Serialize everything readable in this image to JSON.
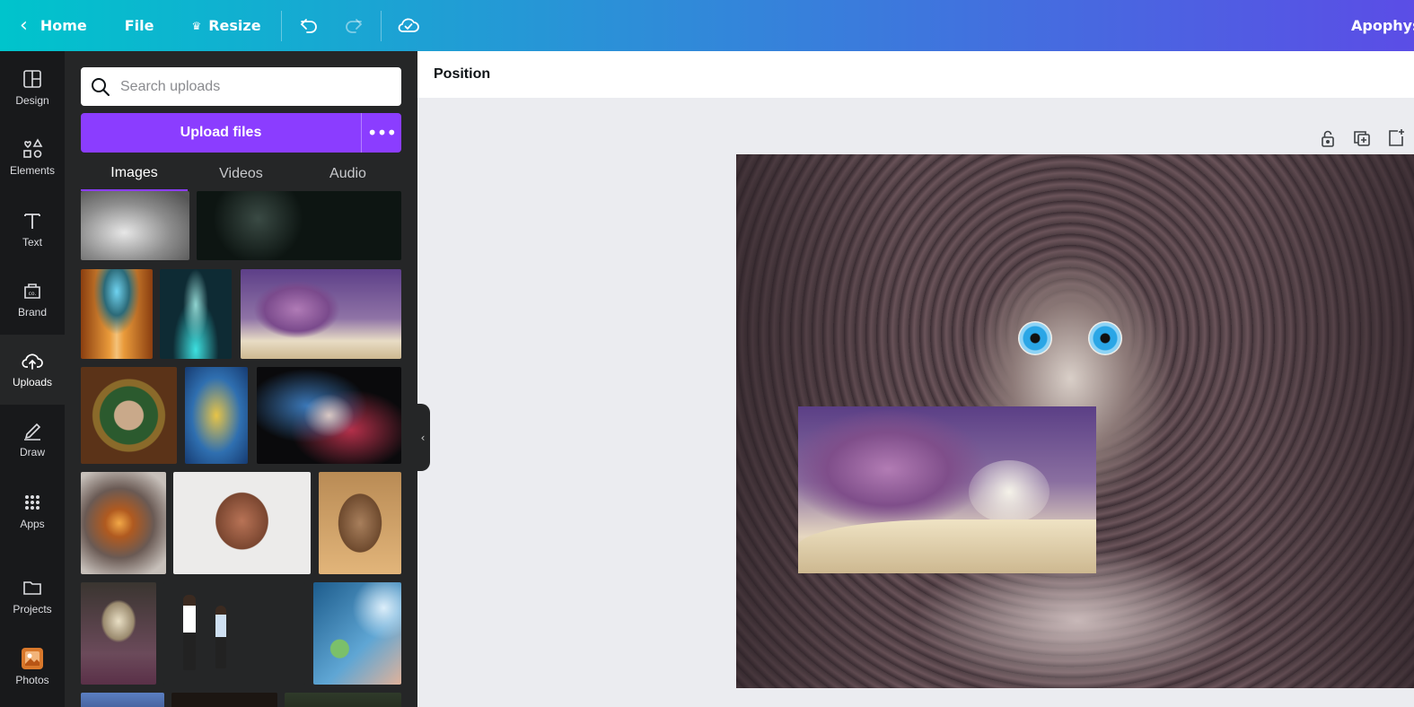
{
  "topbar": {
    "home_label": "Home",
    "file_label": "File",
    "resize_label": "Resize",
    "title": "Apophys"
  },
  "rail": [
    {
      "label": "Design",
      "icon": "layout-icon"
    },
    {
      "label": "Elements",
      "icon": "shapes-icon"
    },
    {
      "label": "Text",
      "icon": "text-icon"
    },
    {
      "label": "Brand",
      "icon": "brand-icon"
    },
    {
      "label": "Uploads",
      "icon": "cloud-upload-icon",
      "active": true
    },
    {
      "label": "Draw",
      "icon": "pen-icon"
    },
    {
      "label": "Apps",
      "icon": "grid-icon"
    },
    {
      "label": "Projects",
      "icon": "folder-icon"
    },
    {
      "label": "Photos",
      "icon": "photos-icon"
    }
  ],
  "panel": {
    "search_placeholder": "Search uploads",
    "upload_label": "Upload files",
    "more_label": "•••",
    "tabs": [
      "Images",
      "Videos",
      "Audio"
    ]
  },
  "editor": {
    "position_label": "Position"
  },
  "colors": {
    "accent": "#8b3dff",
    "rail_bg": "#18191b",
    "panel_bg": "#252627"
  }
}
